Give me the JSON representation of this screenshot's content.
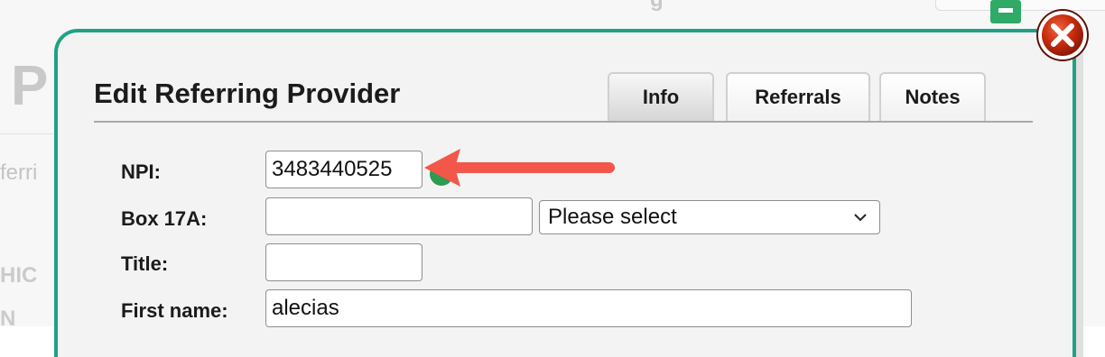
{
  "background": {
    "big_letter": "P",
    "referring_fragment": "ferri",
    "hic_fragment": "HIC",
    "n_fragment": "N",
    "top_fragment": "g"
  },
  "dialog": {
    "title": "Edit Referring Provider",
    "tabs": [
      {
        "label": "Info",
        "active": true
      },
      {
        "label": "Referrals",
        "active": false
      },
      {
        "label": "Notes",
        "active": false
      }
    ],
    "close_icon": "close-icon",
    "border_color": "#1fa283",
    "close_color": "#c62a0c"
  },
  "form": {
    "npi": {
      "label": "NPI:",
      "value": "3483440525"
    },
    "box17a": {
      "label": "Box 17A:",
      "value": "",
      "select_value": "Please select"
    },
    "title": {
      "label": "Title:",
      "value": ""
    },
    "first_name": {
      "label": "First name:",
      "value": "alecias"
    }
  },
  "annotation": {
    "arrow_color": "#f2574a",
    "points_to": "npi-field"
  }
}
